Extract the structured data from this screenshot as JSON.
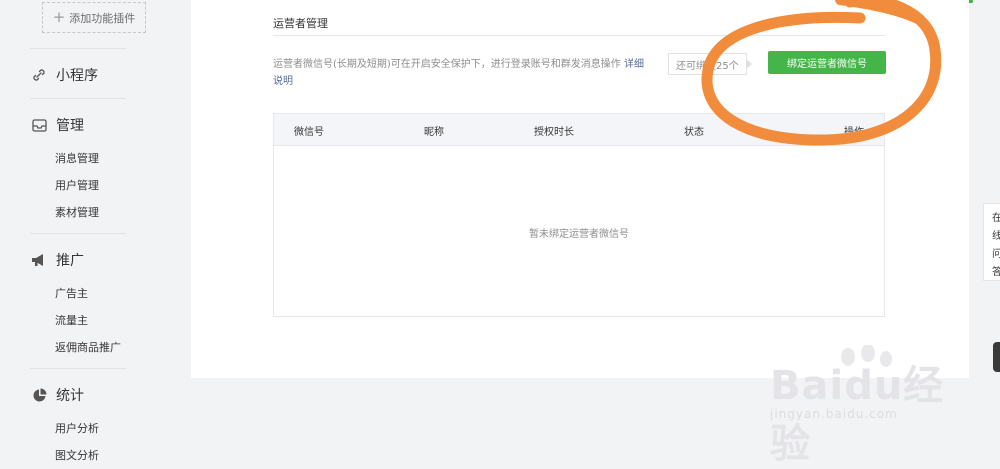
{
  "sidebar": {
    "add_plugin": "添加功能插件",
    "groups": [
      {
        "label": "小程序",
        "icon": "link-icon"
      },
      {
        "label": "管理",
        "icon": "inbox-icon",
        "items": [
          "消息管理",
          "用户管理",
          "素材管理"
        ]
      },
      {
        "label": "推广",
        "icon": "megaphone-icon",
        "items": [
          "广告主",
          "流量主",
          "返佣商品推广"
        ]
      },
      {
        "label": "统计",
        "icon": "pie-chart-icon",
        "items": [
          "用户分析",
          "图文分析"
        ]
      }
    ]
  },
  "main": {
    "section_title": "运营者管理",
    "description": "运营者微信号(长期及短期)可在开启安全保护下，进行登录账号和群发消息操作",
    "description_link_1": "详细",
    "description_link_2": "说明",
    "remaining": "还可绑定25个",
    "bind_button": "绑定运营者微信号",
    "table_headers": [
      "微信号",
      "昵称",
      "授权时长",
      "状态",
      "操作"
    ],
    "empty_text": "暂未绑定运营者微信号"
  },
  "side_tooltip": [
    "在",
    "线",
    "问",
    "答"
  ],
  "watermark": {
    "brand": "Baidu经验",
    "url": "jingyan.baidu.com"
  },
  "colors": {
    "accent_green": "#44b549",
    "link_blue": "#576b95",
    "annotation_orange": "#f08c3c"
  }
}
